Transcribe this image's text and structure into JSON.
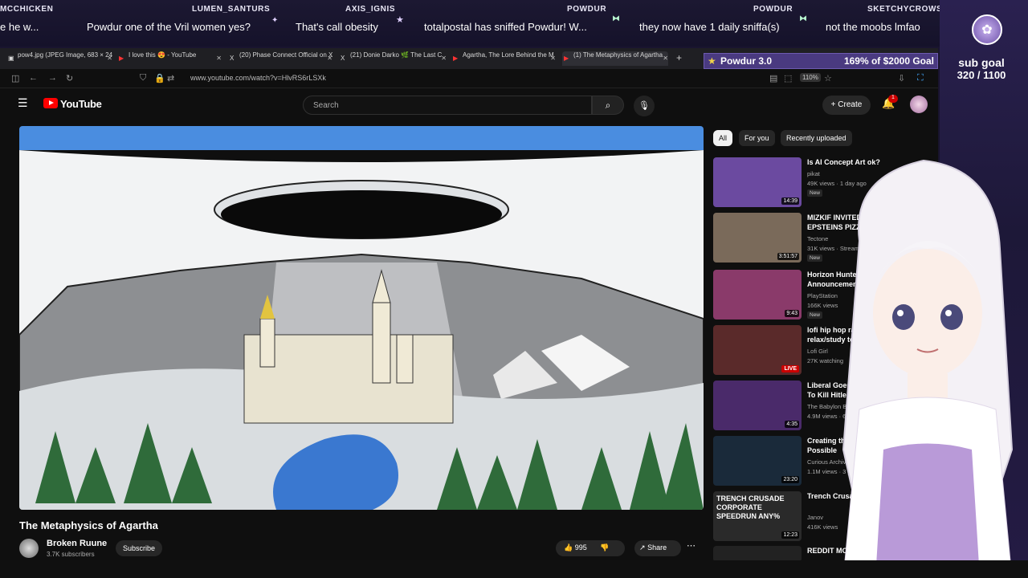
{
  "chat": [
    {
      "name": "MCCHICKEN",
      "msg": "e he w..."
    },
    {
      "name": "",
      "msg": "Powdur one of the Vril women yes?"
    },
    {
      "name": "LUMEN_SANTURS",
      "msg": "That's call obesity"
    },
    {
      "name": "AXIS_IGNIS",
      "msg": "totalpostal has sniffed Powdur! W..."
    },
    {
      "name": "POWDUR",
      "msg": "they now have 1 daily sniffa(s)"
    },
    {
      "name": "POWDUR",
      "msg": "not the moobs lmfao"
    },
    {
      "name": "SKETCHYCROWS",
      "msg": ""
    }
  ],
  "subgoal": {
    "line1": "sub goal",
    "line2": "320 / 1100"
  },
  "donation": {
    "title": "Powdur 3.0",
    "progress": "169% of $2000 Goal",
    "fill": 1.0
  },
  "tabs": [
    {
      "label": "pow4.jpg (JPEG Image, 683 × 247 p",
      "icon": "▣"
    },
    {
      "label": "I love this 😍 - YouTube",
      "icon": "▶"
    },
    {
      "label": "(20) Phase Connect Official on X",
      "icon": "X"
    },
    {
      "label": "(21) Donie Darko 🌿 The Last C",
      "icon": "X"
    },
    {
      "label": "Agartha, The Lore Behind the M",
      "icon": "▶"
    },
    {
      "label": "(1) The Metaphysics of Agartha",
      "icon": "▶"
    }
  ],
  "url": "www.youtube.com/watch?v=HlvRS6rLSXk",
  "zoom": "110%",
  "youtube": {
    "logo": "YouTube",
    "search_placeholder": "Search",
    "create": "Create",
    "notif_count": "1"
  },
  "video": {
    "title": "The Metaphysics of Agartha",
    "channel": "Broken Ruune",
    "subscribers": "3.7K subscribers",
    "subscribe": "Subscribe",
    "likes": "995",
    "share": "Share"
  },
  "chips": [
    "All",
    "For you",
    "Recently uploaded"
  ],
  "recommendations": [
    {
      "title": "Is AI Concept Art ok?",
      "channel": "pikat",
      "meta": "49K views · 1 day ago",
      "duration": "14:39",
      "badge": "New",
      "thumb": "#6b4aa0"
    },
    {
      "title": "MIZKIF INVITED ME TO EPSTEINS PIZZA...",
      "channel": "Tectone",
      "meta": "31K views · Streamed",
      "duration": "3:51:57",
      "badge": "New",
      "thumb": "#7a6a5a"
    },
    {
      "title": "Horizon Hunters Gathering Announcement",
      "channel": "PlayStation",
      "meta": "166K views",
      "duration": "9:43",
      "badge": "New",
      "thumb": "#8a3a6a"
    },
    {
      "title": "lofi hip hop radio - beats to relax/study to",
      "channel": "Lofi Girl",
      "meta": "27K watching",
      "duration": "LIVE",
      "badge": "",
      "thumb": "#5a2a2a"
    },
    {
      "title": "Liberal Goes Back In Time To Kill Hitler",
      "channel": "The Babylon Bee",
      "meta": "4.9M views · 6 months ago",
      "duration": "4:35",
      "badge": "",
      "thumb": "#4a2a6a"
    },
    {
      "title": "Creating the Largest Possible",
      "channel": "Curious Archive",
      "meta": "1.1M views · 3 years ago",
      "duration": "23:20",
      "badge": "",
      "thumb": "#1a2a3a"
    },
    {
      "title": "Trench Crusade is here!",
      "channel": "Janov",
      "meta": "416K views",
      "duration": "12:23",
      "badge": "",
      "thumb": "#2a2a2a",
      "thumb_text": "TRENCH CRUSADE CORPORATE SPEEDRUN ANY%"
    },
    {
      "title": "REDDIT MOD",
      "channel": "",
      "meta": "",
      "duration": "",
      "badge": "",
      "thumb": "#222"
    }
  ]
}
